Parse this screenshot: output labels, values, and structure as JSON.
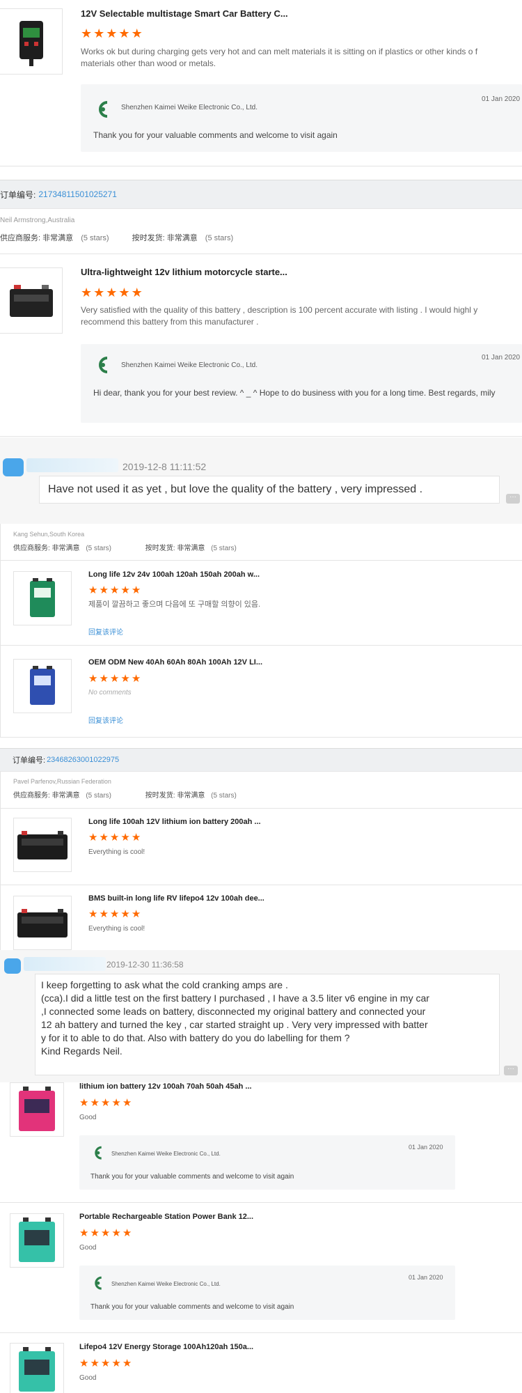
{
  "accent": "#ff6a00",
  "link_color": "#3a8fd6",
  "icons": {
    "star": "★",
    "logo": "kaimei-logo",
    "chat_more": "···"
  },
  "block1": {
    "title": "12V Selectable multistage Smart Car Battery C...",
    "rating": 5,
    "comment": "Works ok but during charging gets very hot and can melt materials it is sitting on if plastics or other kinds o f materials other than wood or metals.",
    "reply": {
      "company": "Shenzhen Kaimei Weike Electronic Co., Ltd.",
      "date": "01 Jan 2020",
      "text": "Thank you for your valuable comments and welcome to visit again"
    }
  },
  "order1": {
    "label": "订单编号:",
    "number": "21734811501025271",
    "buyer": "Neil Armstrong,Australia",
    "service_label": "供应商服务:",
    "service_value": "非常满意",
    "service_stars": "(5 stars)",
    "ship_label": "按时发货:",
    "ship_value": "非常满意",
    "ship_stars": "(5 stars)"
  },
  "block2": {
    "title": "Ultra-lightweight 12v lithium motorcycle starte...",
    "rating": 5,
    "comment": "Very satisfied with the quality of this battery , description is 100 percent accurate with listing . I would highl y recommend this battery from this manufacturer .",
    "reply": {
      "company": "Shenzhen Kaimei Weike Electronic Co., Ltd.",
      "date": "01 Jan 2020",
      "text": "Hi dear, thank you for your best review. ^ _ ^ Hope to do business with you for a long time. Best regards, mily"
    }
  },
  "chat1": {
    "time": "2019-12-8 11:11:52",
    "message": "Have not used it as yet , but love the quality of the battery , very impressed ."
  },
  "order2": {
    "buyer": "Kang Sehun,South Korea",
    "service_label": "供应商服务:",
    "service_value": "非常满意",
    "service_stars": "(5 stars)",
    "ship_label": "按时发货:",
    "ship_value": "非常满意",
    "ship_stars": "(5 stars)",
    "items": [
      {
        "title": "Long life 12v 24v 100ah 120ah 150ah 200ah w...",
        "rating": 5,
        "comment": "제품이 깔끔하고 좋으며 다음에 또 구매할 의향이 있음.",
        "reply_link": "回复该评论"
      },
      {
        "title": "OEM ODM New 40Ah 60Ah 80Ah 100Ah 12V LI...",
        "rating": 5,
        "comment": "No comments",
        "reply_link": "回复该评论"
      }
    ]
  },
  "order3": {
    "label": "订单编号:",
    "number": "23468263001022975",
    "buyer": "Pavel Parfenov,Russian Federation",
    "service_label": "供应商服务:",
    "service_value": "非常满意",
    "service_stars": "(5 stars)",
    "ship_label": "按时发货:",
    "ship_value": "非常满意",
    "ship_stars": "(5 stars)",
    "items": [
      {
        "title": "Long life 100ah 12V lithium ion battery 200ah ...",
        "rating": 5,
        "comment": "Everything is cool!"
      },
      {
        "title": "BMS built-in long life RV lifepo4 12v 100ah dee...",
        "rating": 5,
        "comment": "Everything is cool!"
      }
    ]
  },
  "chat2": {
    "time": "2019-12-30 11:36:58",
    "lines": [
      "I keep forgetting to ask what the cold cranking amps are .",
      "(cca).I did a little test on the first battery I purchased , I have a 3.5 liter v6 engine in my car",
      ",I connected some leads on battery, disconnected my original battery and connected your",
      "12 ah battery and turned the key , car started straight up . Very very impressed with batter",
      "y for it to able to do that. Also with battery do you do labelling for them ?",
      "Kind Regards Neil."
    ]
  },
  "block4": {
    "items": [
      {
        "title": "lithium ion battery 12v 100ah 70ah 50ah 45ah ...",
        "rating": 5,
        "comment": "Good",
        "reply": null
      },
      {
        "title": "Portable Rechargeable Station Power Bank 12...",
        "rating": 5,
        "comment": "Good",
        "reply": null
      },
      {
        "title": "Lifepo4 12V Energy Storage 100Ah120ah 150a...",
        "rating": 5,
        "comment": "Good"
      }
    ],
    "replies": [
      {
        "company": "Shenzhen Kaimei Weike Electronic Co., Ltd.",
        "date": "01 Jan 2020",
        "text": "Thank you for your valuable comments and welcome to visit again"
      },
      {
        "company": "Shenzhen Kaimei Weike Electronic Co., Ltd.",
        "date": "01 Jan 2020",
        "text": "Thank you for your valuable comments and welcome to visit again"
      }
    ]
  }
}
